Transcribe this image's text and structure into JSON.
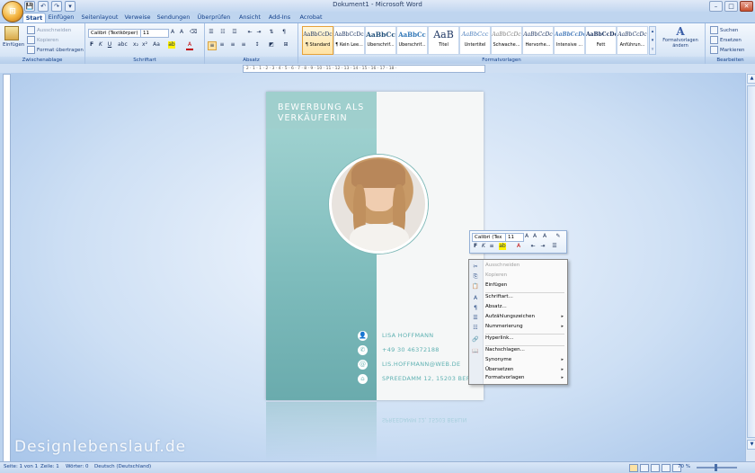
{
  "window": {
    "title": "Dokument1 - Microsoft Word",
    "office_button": "⊞",
    "qat": [
      "💾",
      "↶",
      "↷",
      "▾"
    ],
    "controls": [
      "–",
      "□",
      "✕"
    ]
  },
  "tabs": [
    {
      "label": "Start",
      "active": true
    },
    {
      "label": "Einfügen"
    },
    {
      "label": "Seitenlayout"
    },
    {
      "label": "Verweise"
    },
    {
      "label": "Sendungen"
    },
    {
      "label": "Überprüfen"
    },
    {
      "label": "Ansicht"
    },
    {
      "label": "Add-Ins"
    },
    {
      "label": "Acrobat"
    }
  ],
  "ribbon": {
    "clipboard": {
      "group_label": "Zwischenablage",
      "paste_label": "Einfügen",
      "cut_label": "Ausschneiden",
      "copy_label": "Kopieren",
      "format_painter_label": "Format übertragen"
    },
    "font": {
      "group_label": "Schriftart",
      "font_name": "Calibri (Textkörper)",
      "font_size": "11",
      "bold": "F",
      "italic": "K",
      "underline": "U"
    },
    "paragraph": {
      "group_label": "Absatz"
    },
    "styles": {
      "group_label": "Formatvorlagen",
      "change_label": "Formatvorlagen ändern",
      "items": [
        {
          "preview": "AaBbCcDc",
          "name": "¶ Standard",
          "active": true
        },
        {
          "preview": "AaBbCcDc",
          "name": "¶ Kein Lee..."
        },
        {
          "preview": "AaBbCc",
          "name": "Überschrif..."
        },
        {
          "preview": "AaBbCc",
          "name": "Überschrif..."
        },
        {
          "preview": "AaB",
          "name": "Titel"
        },
        {
          "preview": "AaBbCcc",
          "name": "Untertitel"
        },
        {
          "preview": "AaBbCcDc",
          "name": "Schwache..."
        },
        {
          "preview": "AaBbCcDc",
          "name": "Hervorhe..."
        },
        {
          "preview": "AaBbCcDc",
          "name": "Intensive ..."
        },
        {
          "preview": "AaBbCcDc",
          "name": "Fett"
        },
        {
          "preview": "AaBbCcDc",
          "name": "Anführun..."
        }
      ]
    },
    "editing": {
      "group_label": "Bearbeiten",
      "find_label": "Suchen",
      "replace_label": "Ersetzen",
      "select_label": "Markieren"
    }
  },
  "ruler": {
    "ticks": "· 2 · 1 · 1 · 2 · 3 · 4 · 5 · 6 · 7 · 8 · 9 · 10 · 11 · 12 · 13 · 14 · 15 · 16 · 17 · 18 ·"
  },
  "document": {
    "title": "BEWERBUNG ALS VERKÄUFERIN",
    "contacts": [
      {
        "icon": "👤",
        "text": "LISA HOFFMANN"
      },
      {
        "icon": "✆",
        "text": "+49 30 46372188"
      },
      {
        "icon": "@",
        "text": "LIS.HOFFMANN@WEB.DE"
      },
      {
        "icon": "⌂",
        "text": "SPREEDAMM 12, 15203 BERLIN"
      }
    ],
    "reflection_text": "SPREEDAMM 12, 15203 BERLIN"
  },
  "mini_toolbar": {
    "font_name": "Calibri (Tex",
    "font_size": "11"
  },
  "context_menu": {
    "items": [
      {
        "icon": "✂",
        "label": "Ausschneiden",
        "disabled": true
      },
      {
        "icon": "⎘",
        "label": "Kopieren",
        "disabled": true
      },
      {
        "icon": "📋",
        "label": "Einfügen"
      },
      {
        "icon": "A",
        "label": "Schriftart..."
      },
      {
        "icon": "¶",
        "label": "Absatz..."
      },
      {
        "icon": "☰",
        "label": "Aufzählungszeichen",
        "submenu": true
      },
      {
        "icon": "☷",
        "label": "Nummerierung",
        "submenu": true
      },
      {
        "icon": "🔗",
        "label": "Hyperlink..."
      },
      {
        "icon": "📖",
        "label": "Nachschlagen..."
      },
      {
        "icon": "",
        "label": "Synonyme",
        "submenu": true
      },
      {
        "icon": "",
        "label": "Übersetzen",
        "submenu": true
      },
      {
        "icon": "",
        "label": "Formatvorlagen",
        "submenu": true
      }
    ],
    "submenu_arrow": "▸"
  },
  "status": {
    "page": "Seite: 1 von 1",
    "line": "Zeile: 1",
    "words": "Wörter: 0",
    "language": "Deutsch (Deutschland)",
    "zoom": "70 %"
  },
  "watermark": "Designlebenslauf.de",
  "colors": {
    "teal": "#7ebcbc",
    "teal_text": "#5fb1b2",
    "ribbon_blue": "#15428b"
  }
}
